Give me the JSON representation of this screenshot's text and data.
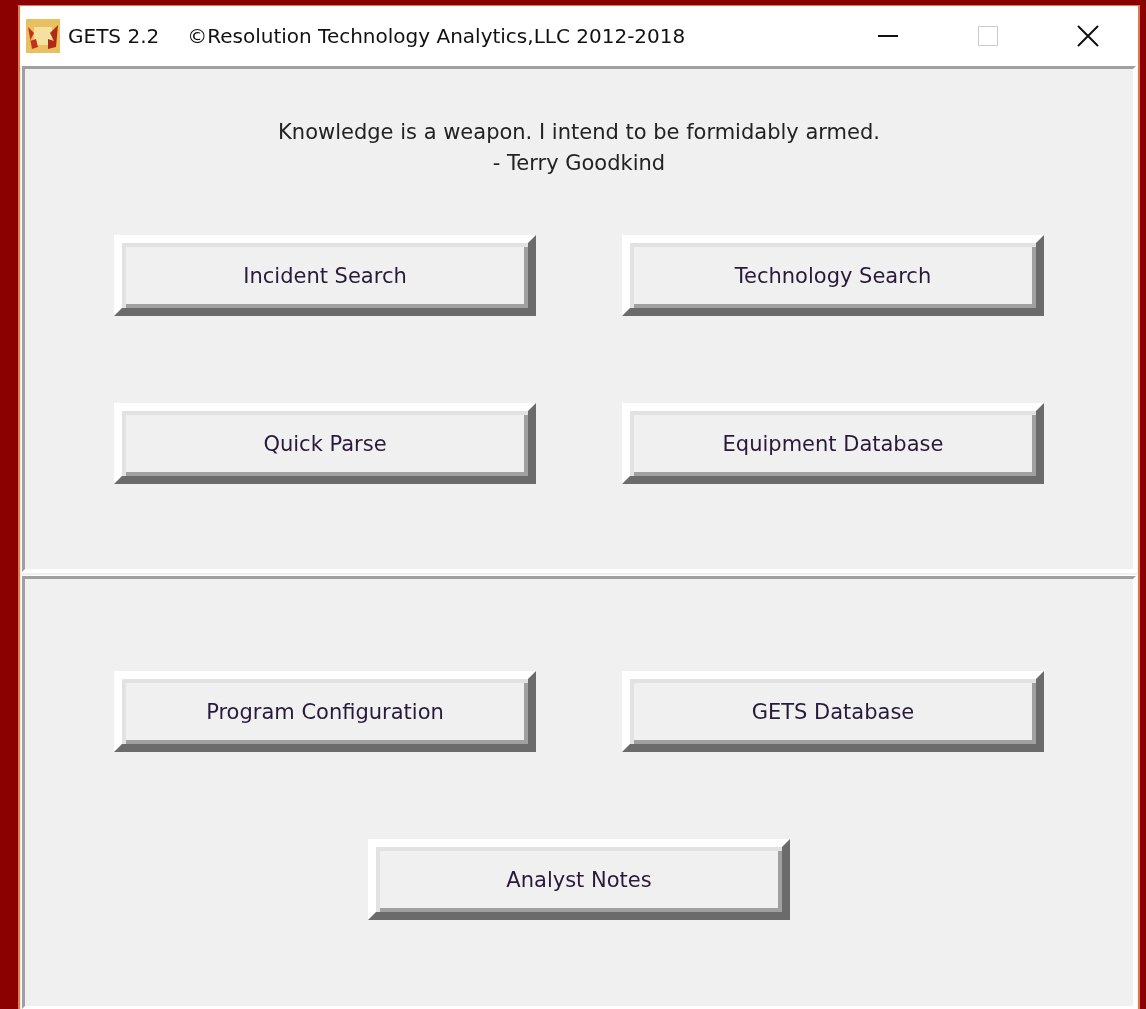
{
  "window": {
    "title": "GETS 2.2",
    "subtitle": "©Resolution Technology Analytics,LLC 2012-2018"
  },
  "quote": {
    "text": "Knowledge is a weapon. I intend to be formidably armed.",
    "author": "- Terry Goodkind"
  },
  "panels": [
    {
      "buttons": [
        {
          "label": "Incident Search"
        },
        {
          "label": "Technology Search"
        },
        {
          "label": "Quick Parse"
        },
        {
          "label": "Equipment Database"
        }
      ]
    },
    {
      "buttons": [
        {
          "label": "Program Configuration"
        },
        {
          "label": "GETS Database"
        },
        {
          "label": "Analyst Notes"
        }
      ]
    }
  ]
}
